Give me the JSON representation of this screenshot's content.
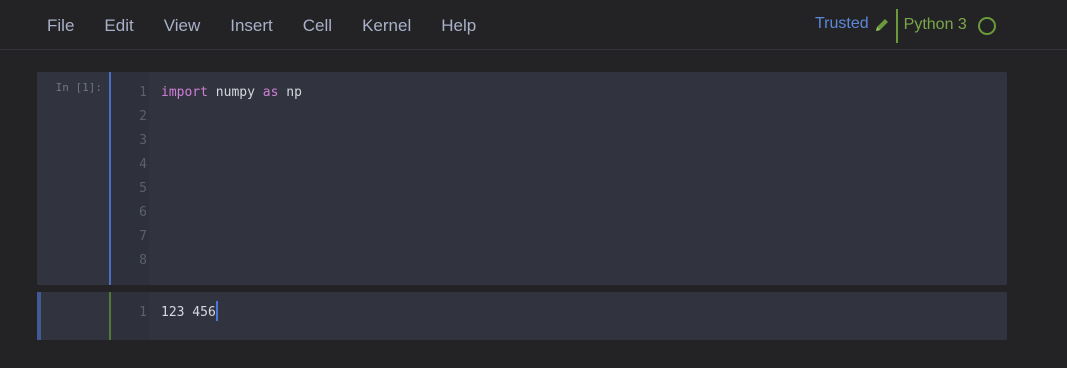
{
  "menu": {
    "items": [
      "File",
      "Edit",
      "View",
      "Insert",
      "Cell",
      "Kernel",
      "Help"
    ]
  },
  "status": {
    "trusted_label": "Trusted",
    "edit_icon": "pencil-icon",
    "kernel_name": "Python 3",
    "kernel_state_icon": "idle-circle-icon"
  },
  "cells": [
    {
      "prompt": "In [1]:",
      "line_numbers": [
        "1",
        "2",
        "3",
        "4",
        "5",
        "6",
        "7",
        "8"
      ],
      "code": {
        "keyword_import": "import",
        "module": " numpy ",
        "keyword_as": "as",
        "alias": " np"
      }
    },
    {
      "prompt": "",
      "line_numbers": [
        "1"
      ],
      "code_text": "123 456"
    }
  ],
  "colors": {
    "background": "#232326",
    "cell_background": "#31333f",
    "menu_text": "#a9b0c8",
    "trusted": "#5d88d8",
    "kernel": "#7aa848",
    "keyword": "#d07fd8",
    "cursor": "#4a78d8"
  }
}
